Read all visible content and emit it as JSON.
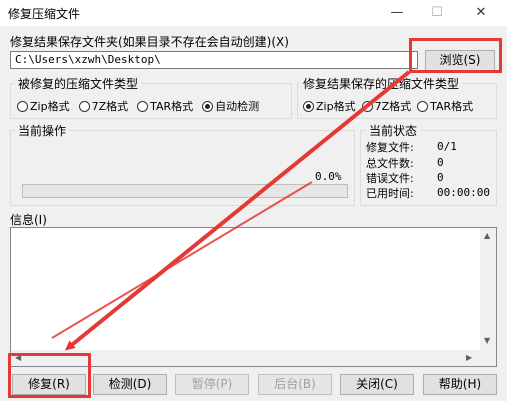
{
  "window": {
    "title": "修复压缩文件",
    "minimize_glyph": "—",
    "maximize_glyph": "☐",
    "close_glyph": "✕"
  },
  "output": {
    "label": "修复结果保存文件夹(如果目录不存在会自动创建)(X)",
    "path_value": "C:\\Users\\xzwh\\Desktop\\",
    "browse_label": "浏览(S)"
  },
  "source_types": {
    "title": "被修复的压缩文件类型",
    "options": [
      "Zip格式",
      "7Z格式",
      "TAR格式",
      "自动检测"
    ],
    "selected": "自动检测"
  },
  "result_types": {
    "title": "修复结果保存的压缩文件类型",
    "options": [
      "Zip格式",
      "7Z格式",
      "TAR格式"
    ],
    "selected": "Zip格式"
  },
  "operation": {
    "title": "当前操作",
    "progress_text": "0.0%",
    "progress_fraction": 0.0
  },
  "status": {
    "title": "当前状态",
    "rows": [
      {
        "label": "修复文件:",
        "value": "0/1"
      },
      {
        "label": "总文件数:",
        "value": "0"
      },
      {
        "label": "错误文件:",
        "value": "0"
      },
      {
        "label": "已用时间:",
        "value": "00:00:00"
      }
    ]
  },
  "info": {
    "label": "信息(I)"
  },
  "buttons": [
    {
      "name": "repair-button",
      "label": "修复(R)"
    },
    {
      "name": "detect-button",
      "label": "检测(D)"
    },
    {
      "name": "pause-button",
      "label": "暂停(P)"
    },
    {
      "name": "background-button",
      "label": "后台(B)"
    },
    {
      "name": "close-button",
      "label": "关闭(C)"
    },
    {
      "name": "help-button",
      "label": "帮助(H)"
    }
  ],
  "colors": {
    "annotation_red": "#e53935"
  }
}
